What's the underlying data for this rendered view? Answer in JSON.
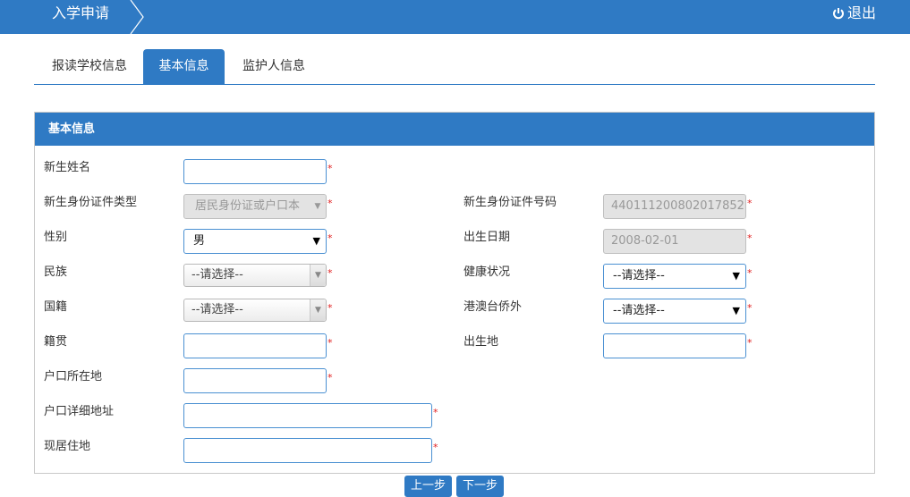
{
  "header": {
    "title": "入学申请",
    "logout_label": "退出"
  },
  "tabs": [
    {
      "label": "报读学校信息"
    },
    {
      "label": "基本信息"
    },
    {
      "label": "监护人信息"
    }
  ],
  "panel": {
    "title": "基本信息"
  },
  "form": {
    "name": {
      "label": "新生姓名",
      "value": ""
    },
    "id_type": {
      "label": "新生身份证件类型",
      "value": "居民身份证或户口本"
    },
    "id_number": {
      "label": "新生身份证件号码",
      "value": "440111200802017852"
    },
    "gender": {
      "label": "性别",
      "value": "男"
    },
    "birth_date": {
      "label": "出生日期",
      "value": "2008-02-01"
    },
    "ethnicity": {
      "label": "民族",
      "value": "--请选择--"
    },
    "health": {
      "label": "健康状况",
      "value": "--请选择--"
    },
    "nationality": {
      "label": "国籍",
      "value": "--请选择--"
    },
    "hk_macau_tw": {
      "label": "港澳台侨外",
      "value": "--请选择--"
    },
    "native_place": {
      "label": "籍贯",
      "value": ""
    },
    "birthplace": {
      "label": "出生地",
      "value": ""
    },
    "household_location": {
      "label": "户口所在地",
      "value": ""
    },
    "household_address": {
      "label": "户口详细地址",
      "value": ""
    },
    "residence": {
      "label": "现居住地",
      "value": ""
    }
  },
  "required_mark": "*",
  "buttons": {
    "prev_label": "上一步",
    "next_label": "下一步"
  },
  "colors": {
    "primary": "#2f7ac4",
    "required": "#e02020"
  }
}
